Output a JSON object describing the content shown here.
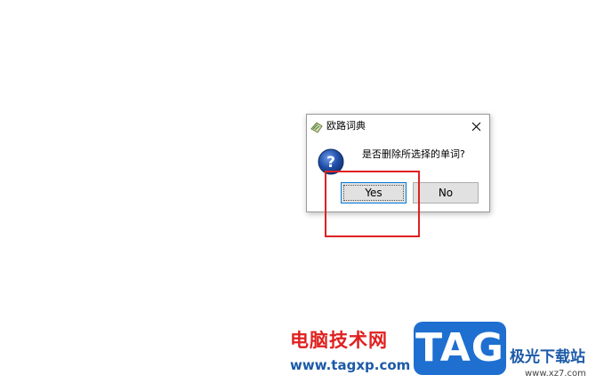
{
  "dialog": {
    "title": "欧路词典",
    "message": "是否删除所选择的单词?",
    "yes_label": "Yes",
    "no_label": "No",
    "icons": {
      "app": "eudic-app-icon",
      "question": "question-icon",
      "close": "close-icon"
    }
  },
  "watermark": {
    "site_name": "电脑技术网",
    "site_url": "www.tagxp.com",
    "logo_text": "TAG",
    "download_site": "极光下载站",
    "download_url": "www.xz7.com"
  },
  "colors": {
    "highlight": "#e02020",
    "focus_border": "#0078d7",
    "question_icon": "#1f4fa8",
    "logo_bg": "#1e6fd0"
  }
}
